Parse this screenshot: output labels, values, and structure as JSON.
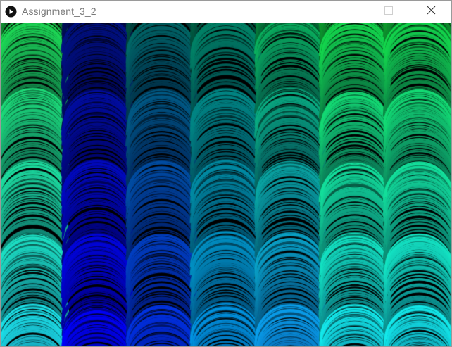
{
  "window": {
    "title": "Assignment_3_2",
    "controls": {
      "minimize_icon": "minimize-icon",
      "maximize_icon": "maximize-icon",
      "close_icon": "close-icon"
    }
  },
  "sketch": {
    "background": "#000000",
    "columns": 7,
    "colors": {
      "top_left": "#1ee65a",
      "blue_column": "#0000ff",
      "bottom_right": "#1ef0f0",
      "green_right": "#14d23c"
    }
  }
}
